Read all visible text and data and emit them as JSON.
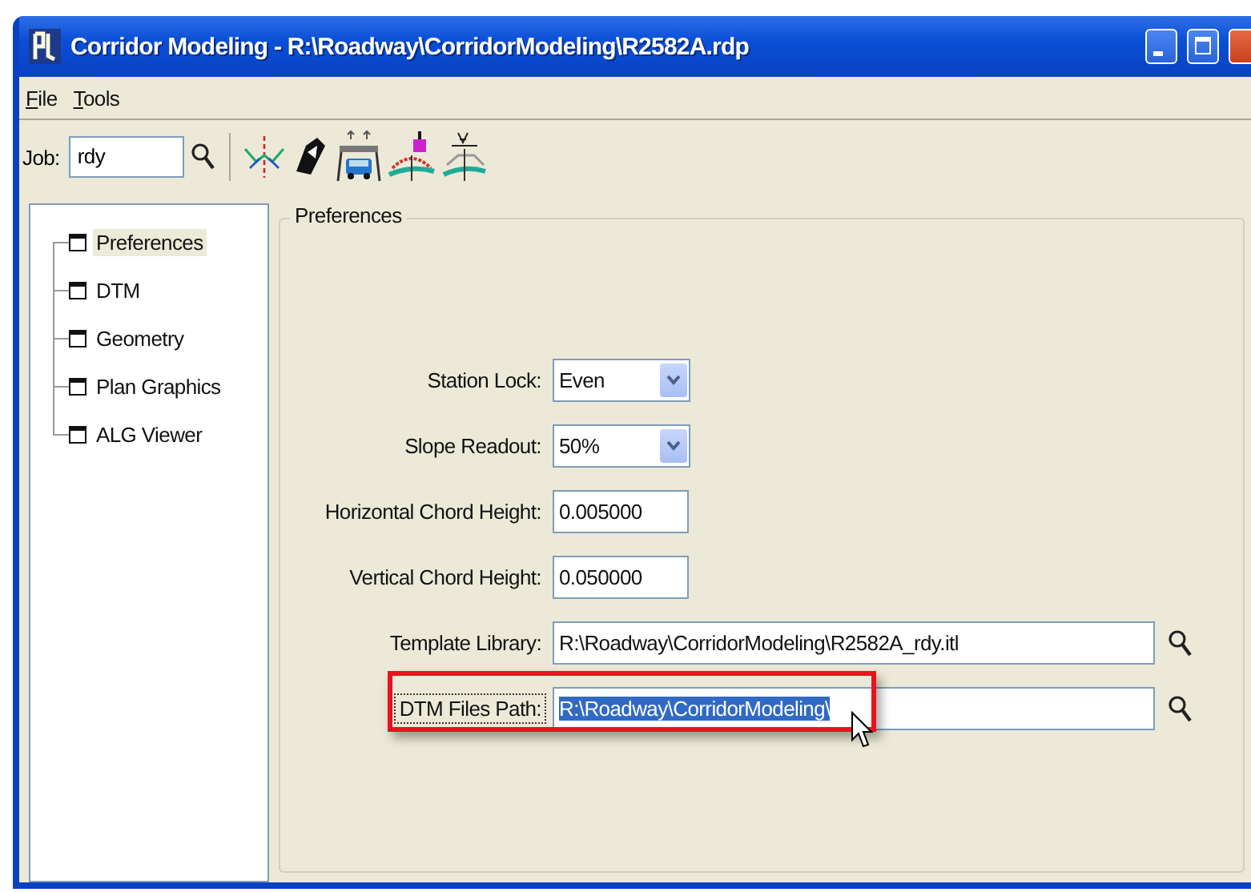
{
  "window": {
    "title": "Corridor Modeling - R:\\Roadway\\CorridorModeling\\R2582A.rdp"
  },
  "menu": [
    {
      "label": "File"
    },
    {
      "label": "Tools"
    }
  ],
  "toolbar": {
    "job_label": "Job:",
    "job_value": "rdy",
    "tools": [
      {
        "kind": "alignment"
      },
      {
        "kind": "design"
      },
      {
        "kind": "roadway"
      },
      {
        "kind": "superelevation"
      },
      {
        "kind": "template"
      }
    ]
  },
  "tree": [
    {
      "label": "Preferences",
      "selected": true
    },
    {
      "label": "DTM",
      "selected": false
    },
    {
      "label": "Geometry",
      "selected": false
    },
    {
      "label": "Plan Graphics",
      "selected": false
    },
    {
      "label": "ALG Viewer",
      "selected": false
    }
  ],
  "group": {
    "title": "Preferences",
    "fields": [
      {
        "kind": "combo",
        "label": "Station Lock:",
        "value": "Even",
        "focused": false,
        "highlighted": false,
        "text_selected": false
      },
      {
        "kind": "combo",
        "label": "Slope Readout:",
        "value": "50%",
        "focused": false,
        "highlighted": false,
        "text_selected": false
      },
      {
        "kind": "text",
        "label": "Horizontal Chord Height:",
        "value": "0.005000",
        "focused": false,
        "highlighted": false,
        "text_selected": false
      },
      {
        "kind": "text",
        "label": "Vertical Chord Height:",
        "value": "0.050000",
        "focused": false,
        "highlighted": false,
        "text_selected": false
      },
      {
        "kind": "path",
        "label": "Template Library:",
        "value": "R:\\Roadway\\CorridorModeling\\R2582A_rdy.itl",
        "focused": false,
        "highlighted": false,
        "text_selected": false
      },
      {
        "kind": "path",
        "label": "DTM Files Path:",
        "value": "R:\\Roadway\\CorridorModeling\\",
        "focused": true,
        "highlighted": true,
        "text_selected": true
      }
    ]
  }
}
